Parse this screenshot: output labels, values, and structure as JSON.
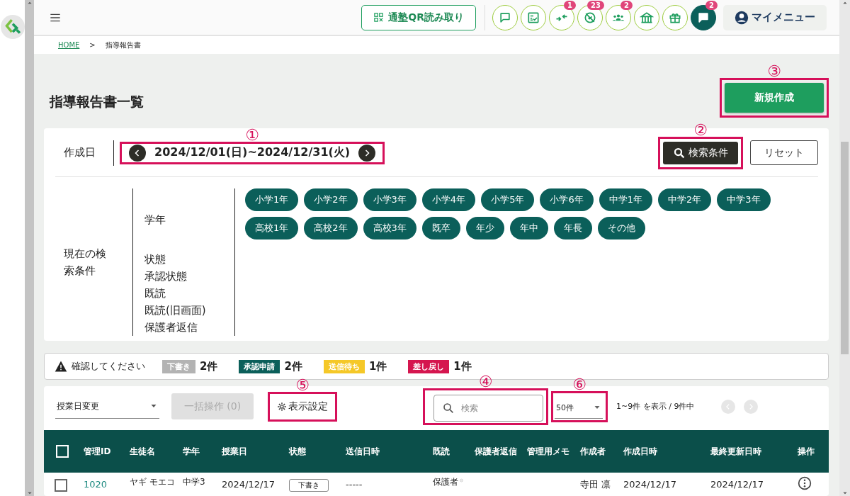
{
  "header": {
    "qr_button": "通塾QR読み取り",
    "icon_buttons": [
      {
        "kind": "chat"
      },
      {
        "kind": "checklist"
      },
      {
        "kind": "arrows",
        "badge": "1"
      },
      {
        "kind": "blocked",
        "badge": "23"
      },
      {
        "kind": "group",
        "badge": "2"
      },
      {
        "kind": "building"
      },
      {
        "kind": "gift"
      },
      {
        "kind": "chat_active",
        "badge": "2"
      }
    ],
    "my_menu": "マイメニュー"
  },
  "breadcrumb": [
    {
      "label": "HOME",
      "link": true
    },
    {
      "label": ">",
      "link": false
    },
    {
      "label": "指導報告書",
      "link": false
    }
  ],
  "page_title": "指導報告書一覧",
  "new_button": {
    "label": "新規作成",
    "annotation": "③"
  },
  "search_panel": {
    "date_label": "作成日",
    "date_range": {
      "value": "2024/12/01(日)~2024/12/31(火)",
      "annotation": "①"
    },
    "search_button": {
      "label": "検索条件",
      "annotation": "②"
    },
    "reset_button": "リセット",
    "conditions_title": "現在の検索条件",
    "conditions": [
      {
        "label": "学年",
        "chips": [
          "小学1年",
          "小学2年",
          "小学3年",
          "小学4年",
          "小学5年",
          "小学6年",
          "中学1年",
          "中学2年",
          "中学3年",
          "高校1年",
          "高校2年",
          "高校3年",
          "既卒",
          "年少",
          "年中",
          "年長",
          "その他"
        ]
      },
      {
        "label": "状態"
      },
      {
        "label": "承認状態"
      },
      {
        "label": "既読"
      },
      {
        "label": "既読(旧画面)"
      },
      {
        "label": "保護者返信"
      }
    ]
  },
  "alert": {
    "message": "確認してください",
    "counts": [
      {
        "tag": "下書き",
        "color": "#b3b3b3",
        "count": "2件"
      },
      {
        "tag": "承認申請",
        "color": "#0b5f5a",
        "count": "2件"
      },
      {
        "tag": "送信待ち",
        "color": "#f5c828",
        "count": "1件"
      },
      {
        "tag": "差し戻し",
        "color": "#d5164f",
        "count": "1件"
      }
    ]
  },
  "toolbar": {
    "date_select": "授業日変更",
    "bulk_button": {
      "label": "一括操作 (0)",
      "disabled": true
    },
    "display_settings": {
      "label": "表示設定",
      "annotation": "⑤"
    },
    "search": {
      "placeholder": "検索",
      "annotation": "④"
    },
    "per_page": {
      "value": "50件",
      "annotation": "⑥"
    },
    "range_text": "1~9件 を表示 / 9件中"
  },
  "table": {
    "header_checked": false,
    "columns": [
      "管理ID",
      "生徒名",
      "学年",
      "授業日",
      "状態",
      "送信日時",
      "既読",
      "保護者返信",
      "管理用メモ",
      "作成者",
      "作成日時",
      "最終更新日時",
      "操作"
    ],
    "rows": [
      {
        "checked": false,
        "id": "1020",
        "student": "ヤギ モエコ",
        "grade": "中学3",
        "lesson_date": "2024/12/17",
        "status": "下書き",
        "sent": "-----",
        "read": "保護者",
        "author": "寺田 凛",
        "created": "2024/12/17",
        "updated": "2024/12/17"
      }
    ]
  }
}
